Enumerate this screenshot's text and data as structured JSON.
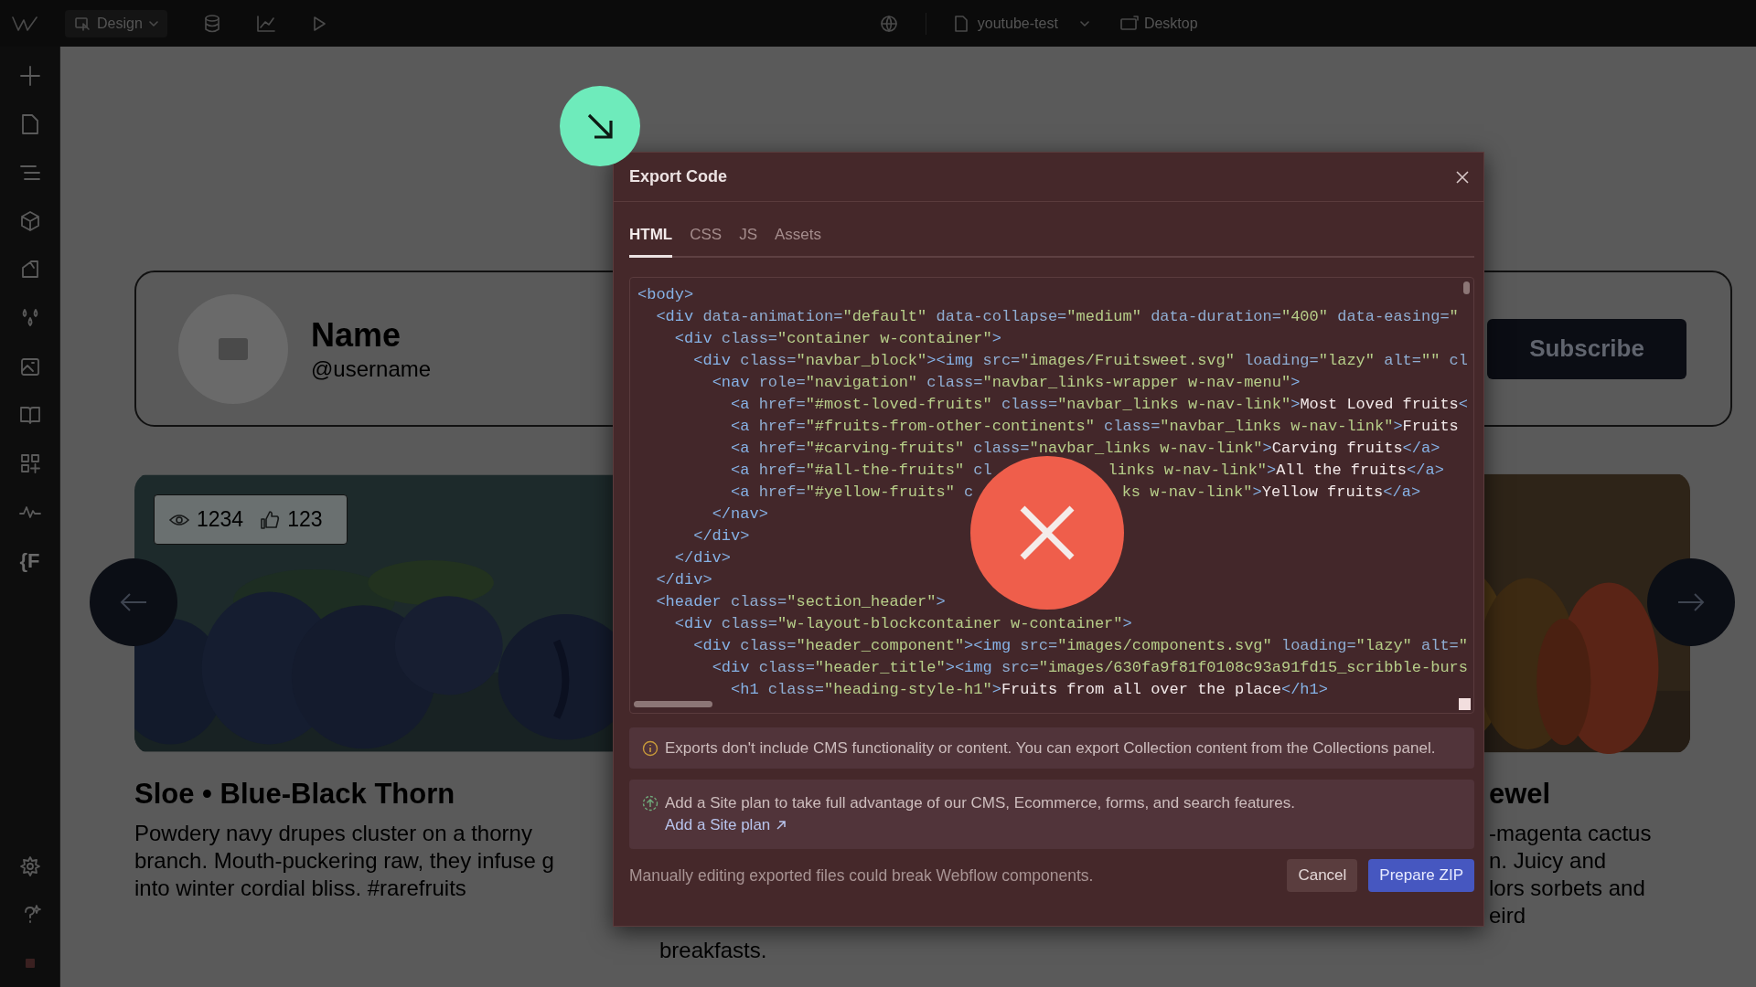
{
  "top_bar": {
    "mode_button": "Design",
    "project": "youtube-test",
    "viewport": "Desktop"
  },
  "sidebar": {
    "variables_label": "{F"
  },
  "profile": {
    "name": "Name",
    "username": "@username",
    "subscribe": "Subscribe"
  },
  "cards": [
    {
      "kind": "picture",
      "views": "1234",
      "likes": "123",
      "title": "Sloe • Blue-Black Thorn",
      "description_lines": [
        "Powdery navy drupes cluster on a thorny",
        "branch. Mouth-puckering raw, they infuse g",
        "into winter cordial bliss. #rarefruits"
      ]
    },
    {
      "kind": "text",
      "description_lines": [
        "breakfasts."
      ]
    },
    {
      "kind": "picture",
      "title": "ewel",
      "description_lines": [
        "-magenta cactus",
        "n. Juicy and",
        "lors sorbets and",
        "eird"
      ]
    }
  ],
  "dialog": {
    "title": "Export Code",
    "tabs": [
      {
        "label": "HTML",
        "selected": true
      },
      {
        "label": "CSS",
        "selected": false
      },
      {
        "label": "JS",
        "selected": false
      },
      {
        "label": "Assets",
        "selected": false
      }
    ],
    "code_lines": [
      {
        "parts": [
          "<body>"
        ]
      },
      {
        "parts": [
          "  <div data-animation=\"default\" data-collapse=\"medium\" data-duration=\"400\" data-easing=\""
        ]
      },
      {
        "parts": [
          "    <div class=\"container w-container\">"
        ]
      },
      {
        "parts": [
          "      <div class=\"navbar_block\"><img src=\"images/Fruitsweet.svg\" loading=\"lazy\" alt=\"\" cl"
        ]
      },
      {
        "parts": [
          "        <nav role=\"navigation\" class=\"navbar_links-wrapper w-nav-menu\">"
        ]
      },
      {
        "parts": [
          "          <a href=\"#most-loved-fruits\" class=\"navbar_links w-nav-link\">Most Loved fruits<"
        ]
      },
      {
        "parts": [
          "          <a href=\"#fruits-from-other-continents\" class=\"navbar_links w-nav-link\">Fruits"
        ]
      },
      {
        "parts": [
          "          <a href=\"#carving-fruits\" class=\"navbar_links w-nav-link\">Carving fruits</a>"
        ]
      },
      {
        "parts": [
          "          <a href=\"#all-the-fruits\" cl",
          "links w-nav-link\">All the fruits</a>"
        ]
      },
      {
        "parts": [
          "          <a href=\"#yellow-fruits\" c",
          "ks w-nav-link\">Yellow fruits</a>"
        ]
      },
      {
        "parts": [
          "        </nav>"
        ]
      },
      {
        "parts": [
          "      </div>"
        ]
      },
      {
        "parts": [
          "    </div>"
        ]
      },
      {
        "parts": [
          "  </div>"
        ]
      },
      {
        "parts": [
          "  <header class=\"section_header\">"
        ]
      },
      {
        "parts": [
          "    <div class=\"w-layout-blockcontainer w-container\">"
        ]
      },
      {
        "parts": [
          "      <div class=\"header_component\"><img src=\"images/components.svg\" loading=\"lazy\" alt=\""
        ]
      },
      {
        "parts": [
          "        <div class=\"header_title\"><img src=\"images/630fa9f81f0108c93a91fd15_scribble-burs"
        ]
      },
      {
        "parts": [
          "          <h1 class=\"heading-style-h1\">Fruits from all over the place</h1>"
        ]
      }
    ],
    "notes": [
      {
        "kind": "info",
        "text": "Exports don't include CMS functionality or content. You can export Collection content from the Collections panel."
      },
      {
        "kind": "upgrade",
        "text": "Add a Site plan to take full advantage of our CMS, Ecommerce, forms, and search features.",
        "link": "Add a Site plan"
      }
    ],
    "footer_text": "Manually editing exported files could break Webflow components.",
    "buttons": [
      {
        "label": "Cancel",
        "kind": "secondary"
      },
      {
        "label": "Prepare ZIP",
        "kind": "primary"
      }
    ]
  }
}
